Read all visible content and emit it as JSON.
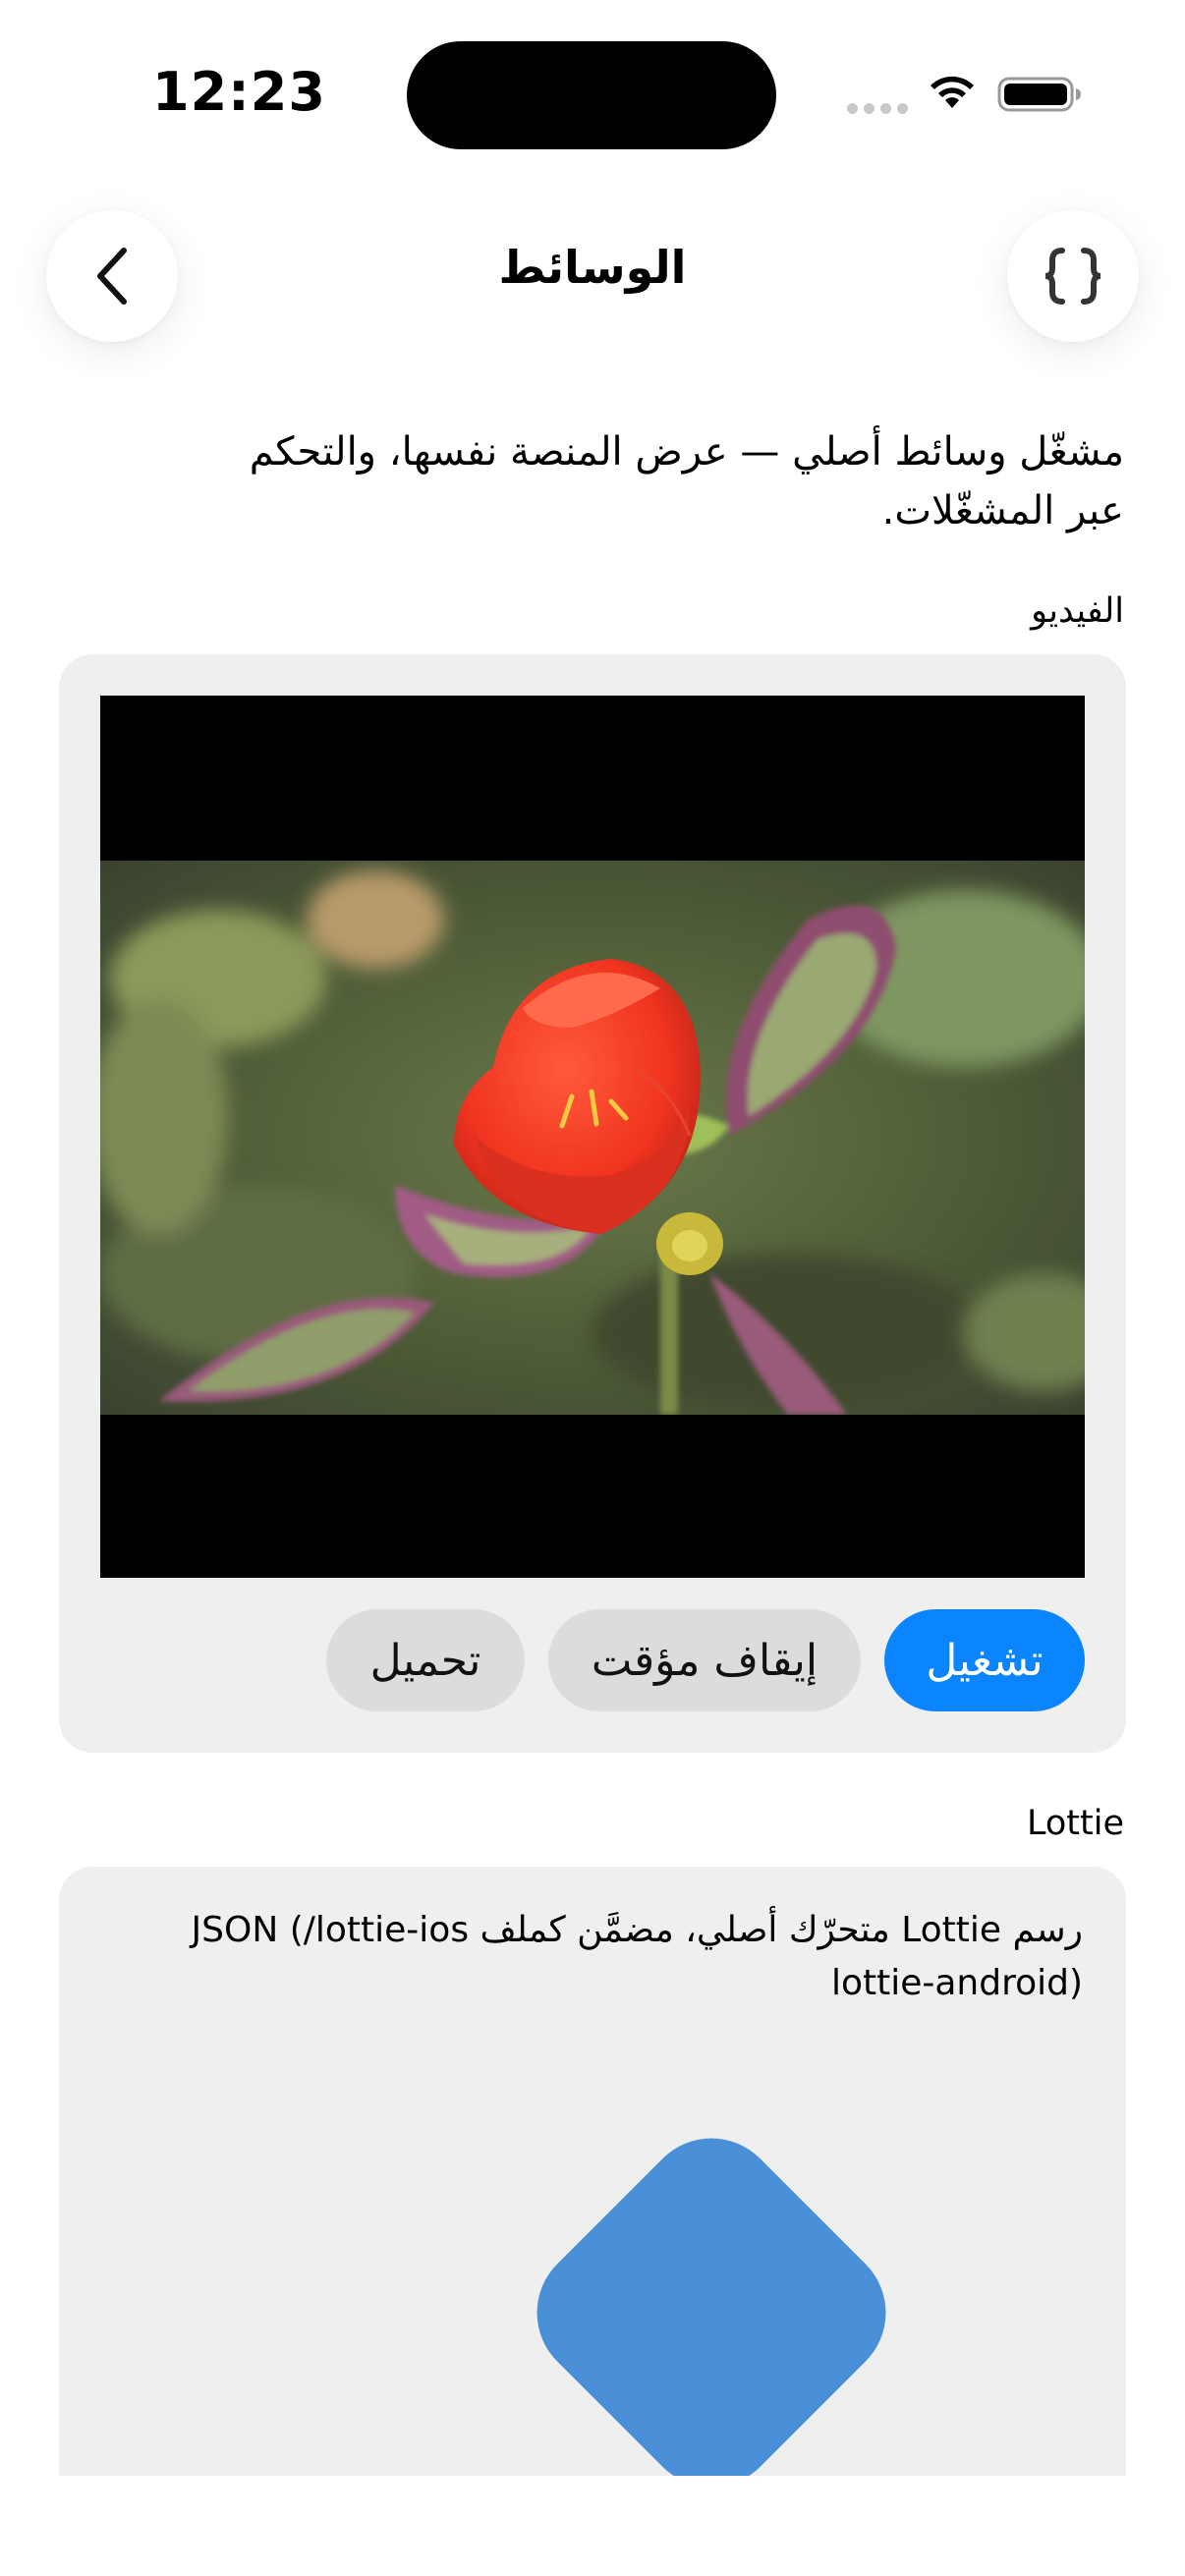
{
  "status_bar": {
    "time": "12:23"
  },
  "nav": {
    "title": "الوسائط",
    "back_icon": "chevron-left-icon",
    "code_icon": "braces-icon"
  },
  "description": "مشغّل وسائط أصلي — عرض المنصة نفسها، والتحكم عبر المشغّلات.",
  "video_section": {
    "label": "الفيديو",
    "controls": {
      "play": "تشغيل",
      "pause": "إيقاف مؤقت",
      "load": "تحميل"
    }
  },
  "lottie_section": {
    "label": "Lottie",
    "caption": "رسم Lottie متحرّك أصلي، مضمَّن كملف JSON (/lottie-ios lottie-android)"
  },
  "colors": {
    "accent": "#0a84ff",
    "lottie_shape": "#4a90d9",
    "card_bg": "#efefef"
  }
}
